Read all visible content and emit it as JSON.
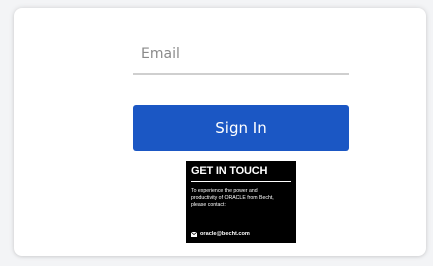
{
  "form": {
    "email_placeholder": "Email",
    "email_value": "",
    "signin_label": "Sign In"
  },
  "get_in_touch": {
    "title": "GET IN TOUCH",
    "body": "To experience the power and productivity of ORACLE from Becht, please contact:",
    "contact_email": "oracle@becht.com",
    "contact_icon": "mail-icon"
  },
  "colors": {
    "page_background": "#f3f4f6",
    "card_background": "#ffffff",
    "primary_button": "#1b57c4",
    "touch_background": "#000000"
  }
}
